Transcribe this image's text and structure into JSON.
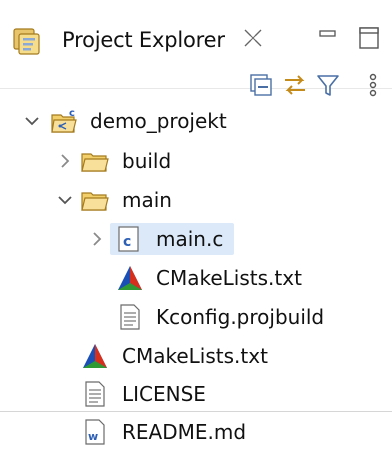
{
  "view": {
    "title": "Project Explorer"
  },
  "tree": [
    {
      "label": "demo_projekt",
      "icon": "c-project-icon",
      "expanded": true,
      "depth": 0,
      "selected": false
    },
    {
      "label": "build",
      "icon": "folder-icon",
      "expanded": false,
      "depth": 1,
      "selected": false
    },
    {
      "label": "main",
      "icon": "folder-open-icon",
      "expanded": true,
      "depth": 1,
      "selected": false
    },
    {
      "label": "main.c",
      "icon": "c-source-icon",
      "expanded": false,
      "depth": 2,
      "selected": true
    },
    {
      "label": "CMakeLists.txt",
      "icon": "cmake-icon",
      "depth": 2,
      "selected": false
    },
    {
      "label": "Kconfig.projbuild",
      "icon": "text-file-icon",
      "depth": 2,
      "selected": false
    },
    {
      "label": "CMakeLists.txt",
      "icon": "cmake-icon",
      "depth": 1,
      "selected": false
    },
    {
      "label": "LICENSE",
      "icon": "text-file-icon",
      "depth": 1,
      "selected": false
    },
    {
      "label": "README.md",
      "icon": "markdown-file-icon",
      "depth": 1,
      "selected": false
    }
  ]
}
